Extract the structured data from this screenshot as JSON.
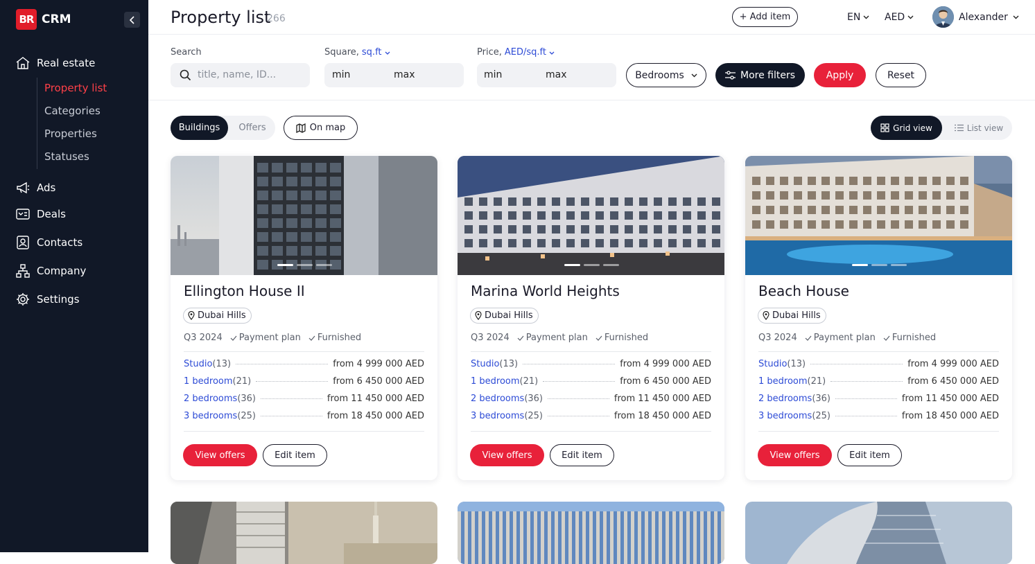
{
  "app": {
    "logo_mark": "BR",
    "logo_text": "CRM"
  },
  "sidebar": {
    "items": [
      {
        "label": "Real estate",
        "icon": "house-icon"
      },
      {
        "label": "Ads",
        "icon": "megaphone-icon"
      },
      {
        "label": "Deals",
        "icon": "deals-icon"
      },
      {
        "label": "Contacts",
        "icon": "contacts-icon"
      },
      {
        "label": "Company",
        "icon": "company-icon"
      },
      {
        "label": "Settings",
        "icon": "gear-icon"
      }
    ],
    "sub_items": [
      "Property list",
      "Categories",
      "Properties",
      "Statuses"
    ],
    "active_sub": "Property list"
  },
  "header": {
    "title": "Property list",
    "count": "266",
    "add_button": "+ Add item",
    "language": "EN",
    "currency": "AED",
    "user_name": "Alexander"
  },
  "filters": {
    "search_label": "Search",
    "search_placeholder": "title, name, ID...",
    "square_label": "Square,",
    "square_unit": "sq.ft",
    "price_label": "Price,",
    "price_unit": "AED/sq.ft",
    "min": "min",
    "max": "max",
    "bedrooms": "Bedrooms",
    "more_filters": "More filters",
    "apply": "Apply",
    "reset": "Reset"
  },
  "toolbar": {
    "tab_buildings": "Buildings",
    "tab_offers": "Offers",
    "on_map": "On map",
    "grid_view": "Grid view",
    "list_view": "List view"
  },
  "cards": [
    {
      "title": "Ellington House II",
      "location": "Dubai Hills",
      "quarter": "Q3 2024",
      "tag1": "Payment plan",
      "tag2": "Furnished",
      "units": [
        {
          "type": "Studio",
          "count": "(13)",
          "price": "from 4 999 000 AED"
        },
        {
          "type": "1 bedroom",
          "count": "(21)",
          "price": "from 6 450 000 AED"
        },
        {
          "type": "2 bedrooms",
          "count": "(36)",
          "price": "from 11 450 000 AED"
        },
        {
          "type": "3 bedrooms",
          "count": "(25)",
          "price": "from 18 450 000 AED"
        }
      ],
      "view_btn": "View offers",
      "edit_btn": "Edit item"
    },
    {
      "title": "Marina World Heights",
      "location": "Dubai Hills",
      "quarter": "Q3 2024",
      "tag1": "Payment plan",
      "tag2": "Furnished",
      "units": [
        {
          "type": "Studio",
          "count": "(13)",
          "price": "from 4 999 000 AED"
        },
        {
          "type": "1 bedroom",
          "count": "(21)",
          "price": "from 6 450 000 AED"
        },
        {
          "type": "2 bedrooms",
          "count": "(36)",
          "price": "from 11 450 000 AED"
        },
        {
          "type": "3 bedrooms",
          "count": "(25)",
          "price": "from 18 450 000 AED"
        }
      ],
      "view_btn": "View offers",
      "edit_btn": "Edit item"
    },
    {
      "title": "Beach House",
      "location": "Dubai Hills",
      "quarter": "Q3 2024",
      "tag1": "Payment plan",
      "tag2": "Furnished",
      "units": [
        {
          "type": "Studio",
          "count": "(13)",
          "price": "from 4 999 000 AED"
        },
        {
          "type": "1 bedroom",
          "count": "(21)",
          "price": "from 6 450 000 AED"
        },
        {
          "type": "2 bedrooms",
          "count": "(36)",
          "price": "from 11 450 000 AED"
        },
        {
          "type": "3 bedrooms",
          "count": "(25)",
          "price": "from 18 450 000 AED"
        }
      ],
      "view_btn": "View offers",
      "edit_btn": "Edit item"
    }
  ],
  "colors": {
    "sidebar_bg": "#111827",
    "accent_red": "#e8213a",
    "link_blue": "#2d4bd6"
  }
}
